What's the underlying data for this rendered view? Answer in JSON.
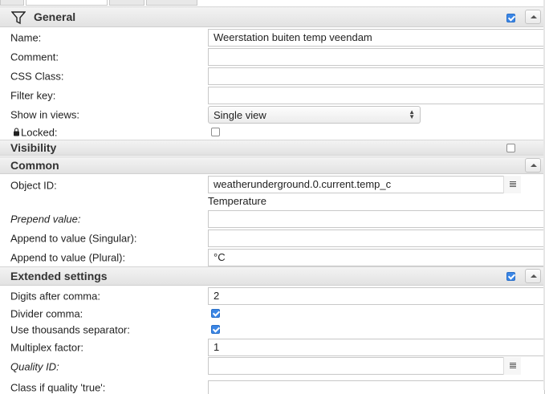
{
  "sections": {
    "general": {
      "title": "General",
      "checked": true
    },
    "visibility": {
      "title": "Visibility",
      "checked": false
    },
    "common": {
      "title": "Common"
    },
    "extended": {
      "title": "Extended settings",
      "checked": true
    }
  },
  "general": {
    "name_label": "Name:",
    "name_value": "Weerstation buiten temp veendam",
    "comment_label": "Comment:",
    "comment_value": "",
    "css_label": "CSS Class:",
    "css_value": "",
    "filter_label": "Filter key:",
    "filter_value": "",
    "views_label": "Show in views:",
    "views_value": "Single view",
    "locked_label": "Locked:",
    "locked_checked": false
  },
  "common": {
    "oid_label": "Object ID:",
    "oid_value": "weatherunderground.0.current.temp_c",
    "oid_desc": "Temperature",
    "prepend_label": "Prepend value:",
    "prepend_value": "",
    "append_singular_label": "Append to value (Singular):",
    "append_singular_value": "",
    "append_plural_label": "Append to value (Plural):",
    "append_plural_value": "°C"
  },
  "extended": {
    "digits_label": "Digits after comma:",
    "digits_value": "2",
    "divider_label": "Divider comma:",
    "divider_checked": true,
    "thousands_label": "Use thousands separator:",
    "thousands_checked": true,
    "multiplex_label": "Multiplex factor:",
    "multiplex_value": "1",
    "quality_label": "Quality ID:",
    "quality_value": "",
    "class_quality_label": "Class if quality 'true':"
  },
  "icons": {
    "filter": "filter-icon",
    "collapse": "chevron-up-icon",
    "picker": "list-icon",
    "lock": "lock-icon"
  }
}
